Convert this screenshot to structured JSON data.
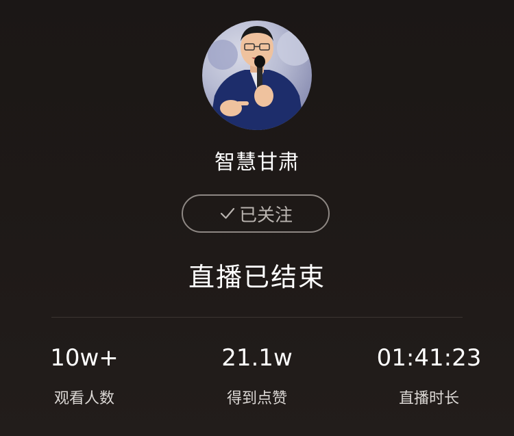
{
  "profile": {
    "name": "智慧甘肃",
    "avatar_icon": "speaker-with-microphone-avatar",
    "follow_button": {
      "label": "已关注",
      "icon": "check-icon"
    }
  },
  "live": {
    "status_text": "直播已结束"
  },
  "stats": [
    {
      "value": "10w+",
      "label": "观看人数"
    },
    {
      "value": "21.1w",
      "label": "得到点赞"
    },
    {
      "value": "01:41:23",
      "label": "直播时长"
    }
  ],
  "colors": {
    "background": "#1b1716",
    "button_border": "#8e8884",
    "button_text": "#b9b4b0",
    "divider": "#3c3633"
  }
}
